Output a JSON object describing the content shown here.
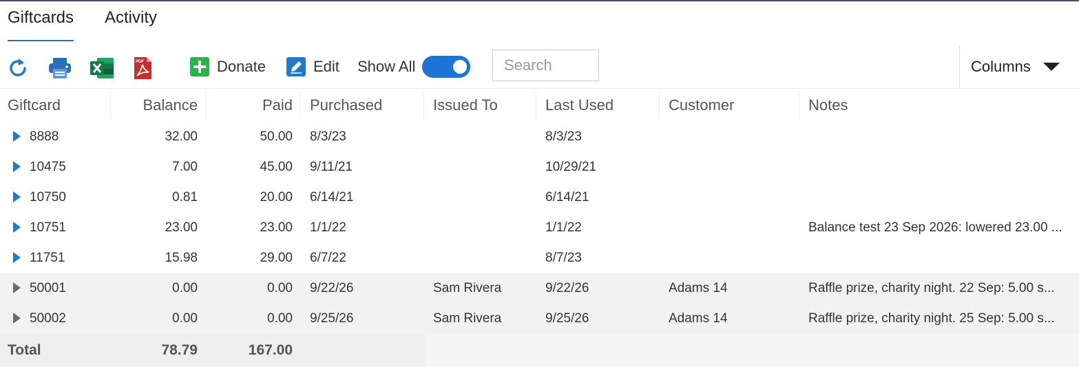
{
  "tabs": [
    {
      "label": "Giftcards",
      "active": true
    },
    {
      "label": "Activity",
      "active": false
    }
  ],
  "toolbar": {
    "refresh_icon": "refresh-icon",
    "print_icon": "printer-icon",
    "excel_icon": "excel-icon",
    "pdf_icon": "pdf-icon",
    "donate_label": "Donate",
    "edit_label": "Edit",
    "show_all_label": "Show All",
    "show_all_on": true,
    "search_placeholder": "Search",
    "columns_label": "Columns"
  },
  "colors": {
    "accent": "#1b74d6",
    "donate_green": "#2bb24c",
    "excel_green": "#1d6f42",
    "pdf_red": "#c4302b",
    "expander_blue": "#1e7bc9"
  },
  "table": {
    "headers": [
      "Giftcard",
      "Balance",
      "Paid",
      "Purchased",
      "Issued To",
      "Last Used",
      "Customer",
      "Notes"
    ],
    "rows": [
      {
        "giftcard": "8888",
        "balance": "32.00",
        "paid": "50.00",
        "purchased": "8/3/23",
        "issued_to": "",
        "last_used": "8/3/23",
        "customer": "",
        "notes": "",
        "shaded": false
      },
      {
        "giftcard": "10475",
        "balance": "7.00",
        "paid": "45.00",
        "purchased": "9/11/21",
        "issued_to": "",
        "last_used": "10/29/21",
        "customer": "",
        "notes": "",
        "shaded": false
      },
      {
        "giftcard": "10750",
        "balance": "0.81",
        "paid": "20.00",
        "purchased": "6/14/21",
        "issued_to": "",
        "last_used": "6/14/21",
        "customer": "",
        "notes": "",
        "shaded": false
      },
      {
        "giftcard": "10751",
        "balance": "23.00",
        "paid": "23.00",
        "purchased": "1/1/22",
        "issued_to": "",
        "last_used": "1/1/22",
        "customer": "",
        "notes": "Balance test 23 Sep 2026: lowered 23.00 ...",
        "shaded": false
      },
      {
        "giftcard": "11751",
        "balance": "15.98",
        "paid": "29.00",
        "purchased": "6/7/22",
        "issued_to": "",
        "last_used": "8/7/23",
        "customer": "",
        "notes": "",
        "shaded": false
      },
      {
        "giftcard": "50001",
        "balance": "0.00",
        "paid": "0.00",
        "purchased": "9/22/26",
        "issued_to": "Sam Rivera",
        "last_used": "9/22/26",
        "customer": "Adams 14",
        "notes": "Raffle prize, charity night. 22 Sep: 5.00 s...",
        "shaded": true
      },
      {
        "giftcard": "50002",
        "balance": "0.00",
        "paid": "0.00",
        "purchased": "9/25/26",
        "issued_to": "Sam Rivera",
        "last_used": "9/25/26",
        "customer": "Adams 14",
        "notes": "Raffle prize, charity night. 25 Sep: 5.00 s...",
        "shaded": true
      }
    ],
    "totals": {
      "label": "Total",
      "balance": "78.79",
      "paid": "167.00"
    }
  }
}
